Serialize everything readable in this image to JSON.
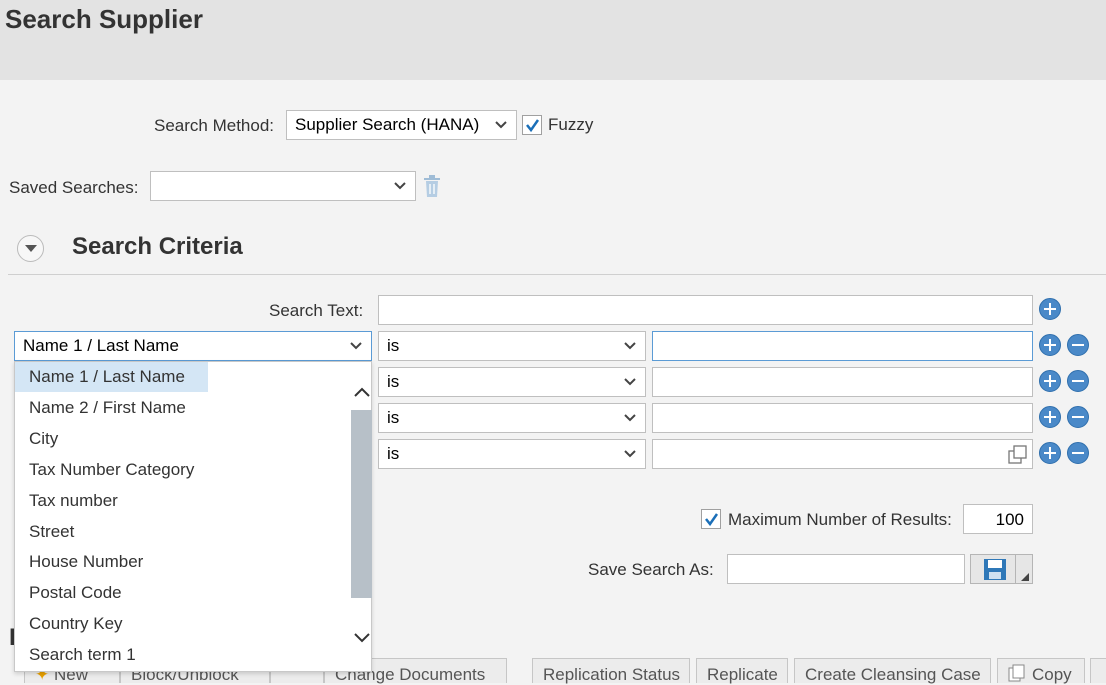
{
  "header": {
    "title": "Search Supplier"
  },
  "search_method": {
    "label": "Search Method:",
    "value": "Supplier Search (HANA)",
    "fuzzy_label": "Fuzzy",
    "fuzzy_checked": true
  },
  "saved_searches": {
    "label": "Saved Searches:",
    "value": ""
  },
  "criteria": {
    "title": "Search Criteria",
    "search_text_label": "Search Text:",
    "rows": [
      {
        "field": "Name 1 / Last Name",
        "operator": "is",
        "value": ""
      },
      {
        "field": "",
        "operator": "is",
        "value": ""
      },
      {
        "field": "",
        "operator": "is",
        "value": ""
      },
      {
        "field": "",
        "operator": "is",
        "value": ""
      }
    ]
  },
  "field_dropdown": {
    "options": [
      "Name 1 / Last Name",
      "Name 2 / First Name",
      "City",
      "Tax Number Category",
      "Tax number",
      "Street",
      "House Number",
      "Postal Code",
      "Country Key",
      "Search term 1"
    ],
    "selected": "Name 1 / Last Name"
  },
  "max_results": {
    "label": "Maximum Number of Results:",
    "checked": true,
    "value": "100"
  },
  "save_search": {
    "label": "Save Search As:",
    "value": ""
  },
  "toolbar": {
    "new_label": "New",
    "block_label": "Block/Unblock",
    "change_docs_label": "Change Documents",
    "replication_status_label": "Replication Status",
    "replicate_label": "Replicate",
    "cleansing_label": "Create Cleansing Case",
    "copy_label": "Copy"
  },
  "colors": {
    "accent": "#4a89c8",
    "focus_border": "#5b9bd5",
    "selected_bg": "#d4e6f5"
  }
}
